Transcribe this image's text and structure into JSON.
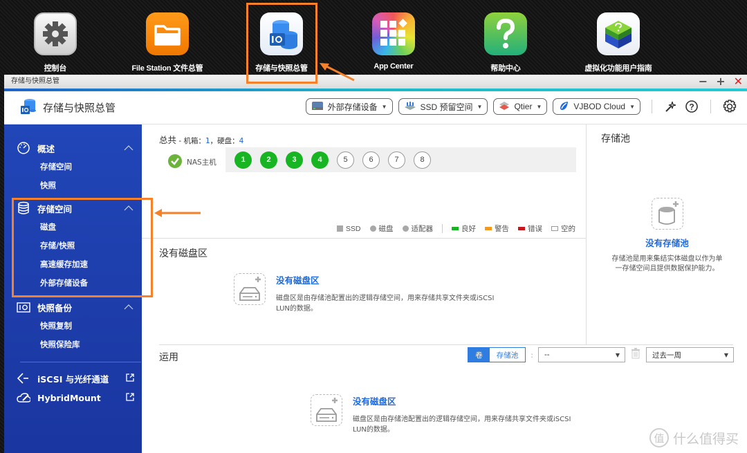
{
  "desktop": {
    "icons": [
      {
        "label": "控制台",
        "icon": "gear-icon"
      },
      {
        "label": "File Station 文件总管",
        "icon": "folder-icon"
      },
      {
        "label": "存储与快照总管",
        "icon": "storage-snapshot-icon",
        "highlighted": true
      },
      {
        "label": "App Center",
        "icon": "app-grid-icon"
      },
      {
        "label": "帮助中心",
        "icon": "question-icon"
      },
      {
        "label": "虚拟化功能用户指南",
        "icon": "virtualization-cube-icon"
      }
    ]
  },
  "window": {
    "title": "存储与快照总管",
    "controls": {
      "minimize": "−",
      "maximize": "+",
      "close": "✕"
    }
  },
  "header": {
    "app_title": "存储与快照总管",
    "tools": [
      {
        "label": "外部存储设备",
        "icon": "external-storage-icon"
      },
      {
        "label": "SSD 预留空间",
        "icon": "ssd-icon"
      },
      {
        "label": "Qtier",
        "icon": "qtier-icon"
      },
      {
        "label": "VJBOD Cloud",
        "icon": "vjbod-cloud-icon"
      }
    ]
  },
  "sidebar": {
    "groups": [
      {
        "label": "概述",
        "icon": "dashboard-icon",
        "expanded": true,
        "items": [
          "存储空间",
          "快照"
        ]
      },
      {
        "label": "存储空间",
        "icon": "database-icon",
        "expanded": true,
        "items": [
          "磁盘",
          "存储/快照",
          "高速缓存加速",
          "外部存储设备"
        ]
      },
      {
        "label": "快照备份",
        "icon": "camera-icon",
        "expanded": true,
        "items": [
          "快照复制",
          "快照保险库"
        ]
      }
    ],
    "links": [
      {
        "label": "iSCSI 与光纤通道",
        "icon": "iscsi-icon"
      },
      {
        "label": "HybridMount",
        "icon": "cloud-mount-icon"
      }
    ]
  },
  "overview": {
    "summary_prefix": "总共",
    "summary_mid": " - 机箱：",
    "enclosures": "1",
    "disks_label": "，硬盘：",
    "disks": "4",
    "nas_label": "NAS主机",
    "nas_status": "good",
    "slots": [
      {
        "n": "1",
        "state": "good"
      },
      {
        "n": "2",
        "state": "good"
      },
      {
        "n": "3",
        "state": "good"
      },
      {
        "n": "4",
        "state": "good"
      },
      {
        "n": "5",
        "state": "empty"
      },
      {
        "n": "6",
        "state": "empty"
      },
      {
        "n": "7",
        "state": "empty"
      },
      {
        "n": "8",
        "state": "empty"
      }
    ],
    "legend": [
      {
        "label": "SSD",
        "shape": "square",
        "color": "#a8a8a8"
      },
      {
        "label": "磁盘",
        "shape": "circle",
        "color": "#a8a8a8"
      },
      {
        "label": "适配器",
        "shape": "circle",
        "color": "#a8a8a8"
      },
      {
        "label": "良好",
        "shape": "bar",
        "color": "#17b521"
      },
      {
        "label": "警告",
        "shape": "bar",
        "color": "#f39a1e"
      },
      {
        "label": "错误",
        "shape": "bar",
        "color": "#c8161d"
      },
      {
        "label": "空的",
        "shape": "hollow",
        "color": "#999999"
      }
    ]
  },
  "volumes": {
    "title": "没有磁盘区",
    "empty_link": "没有磁盘区",
    "empty_desc": "磁盘区是由存储池配置出的逻辑存储空间，用来存储共享文件夹或iSCSI LUN的数据。"
  },
  "pool": {
    "title": "存储池",
    "empty_link": "没有存储池",
    "empty_desc": "存储池是用来集结实体磁盘以作为单一存储空间且提供数据保护能力。"
  },
  "usage": {
    "title": "运用",
    "toggle": [
      "卷",
      "存储池"
    ],
    "toggle_active": "卷",
    "select_value": "--",
    "period": "过去一周",
    "empty_link": "没有磁盘区",
    "empty_desc": "磁盘区是由存储池配置出的逻辑存储空间，用来存储共享文件夹或iSCSI LUN的数据。"
  },
  "colors": {
    "sidebar": "#2146b8",
    "accent": "#1d6ae0",
    "good": "#17b521",
    "highlight": "#f5822a"
  },
  "watermark": {
    "badge": "值",
    "text": "什么值得买"
  }
}
